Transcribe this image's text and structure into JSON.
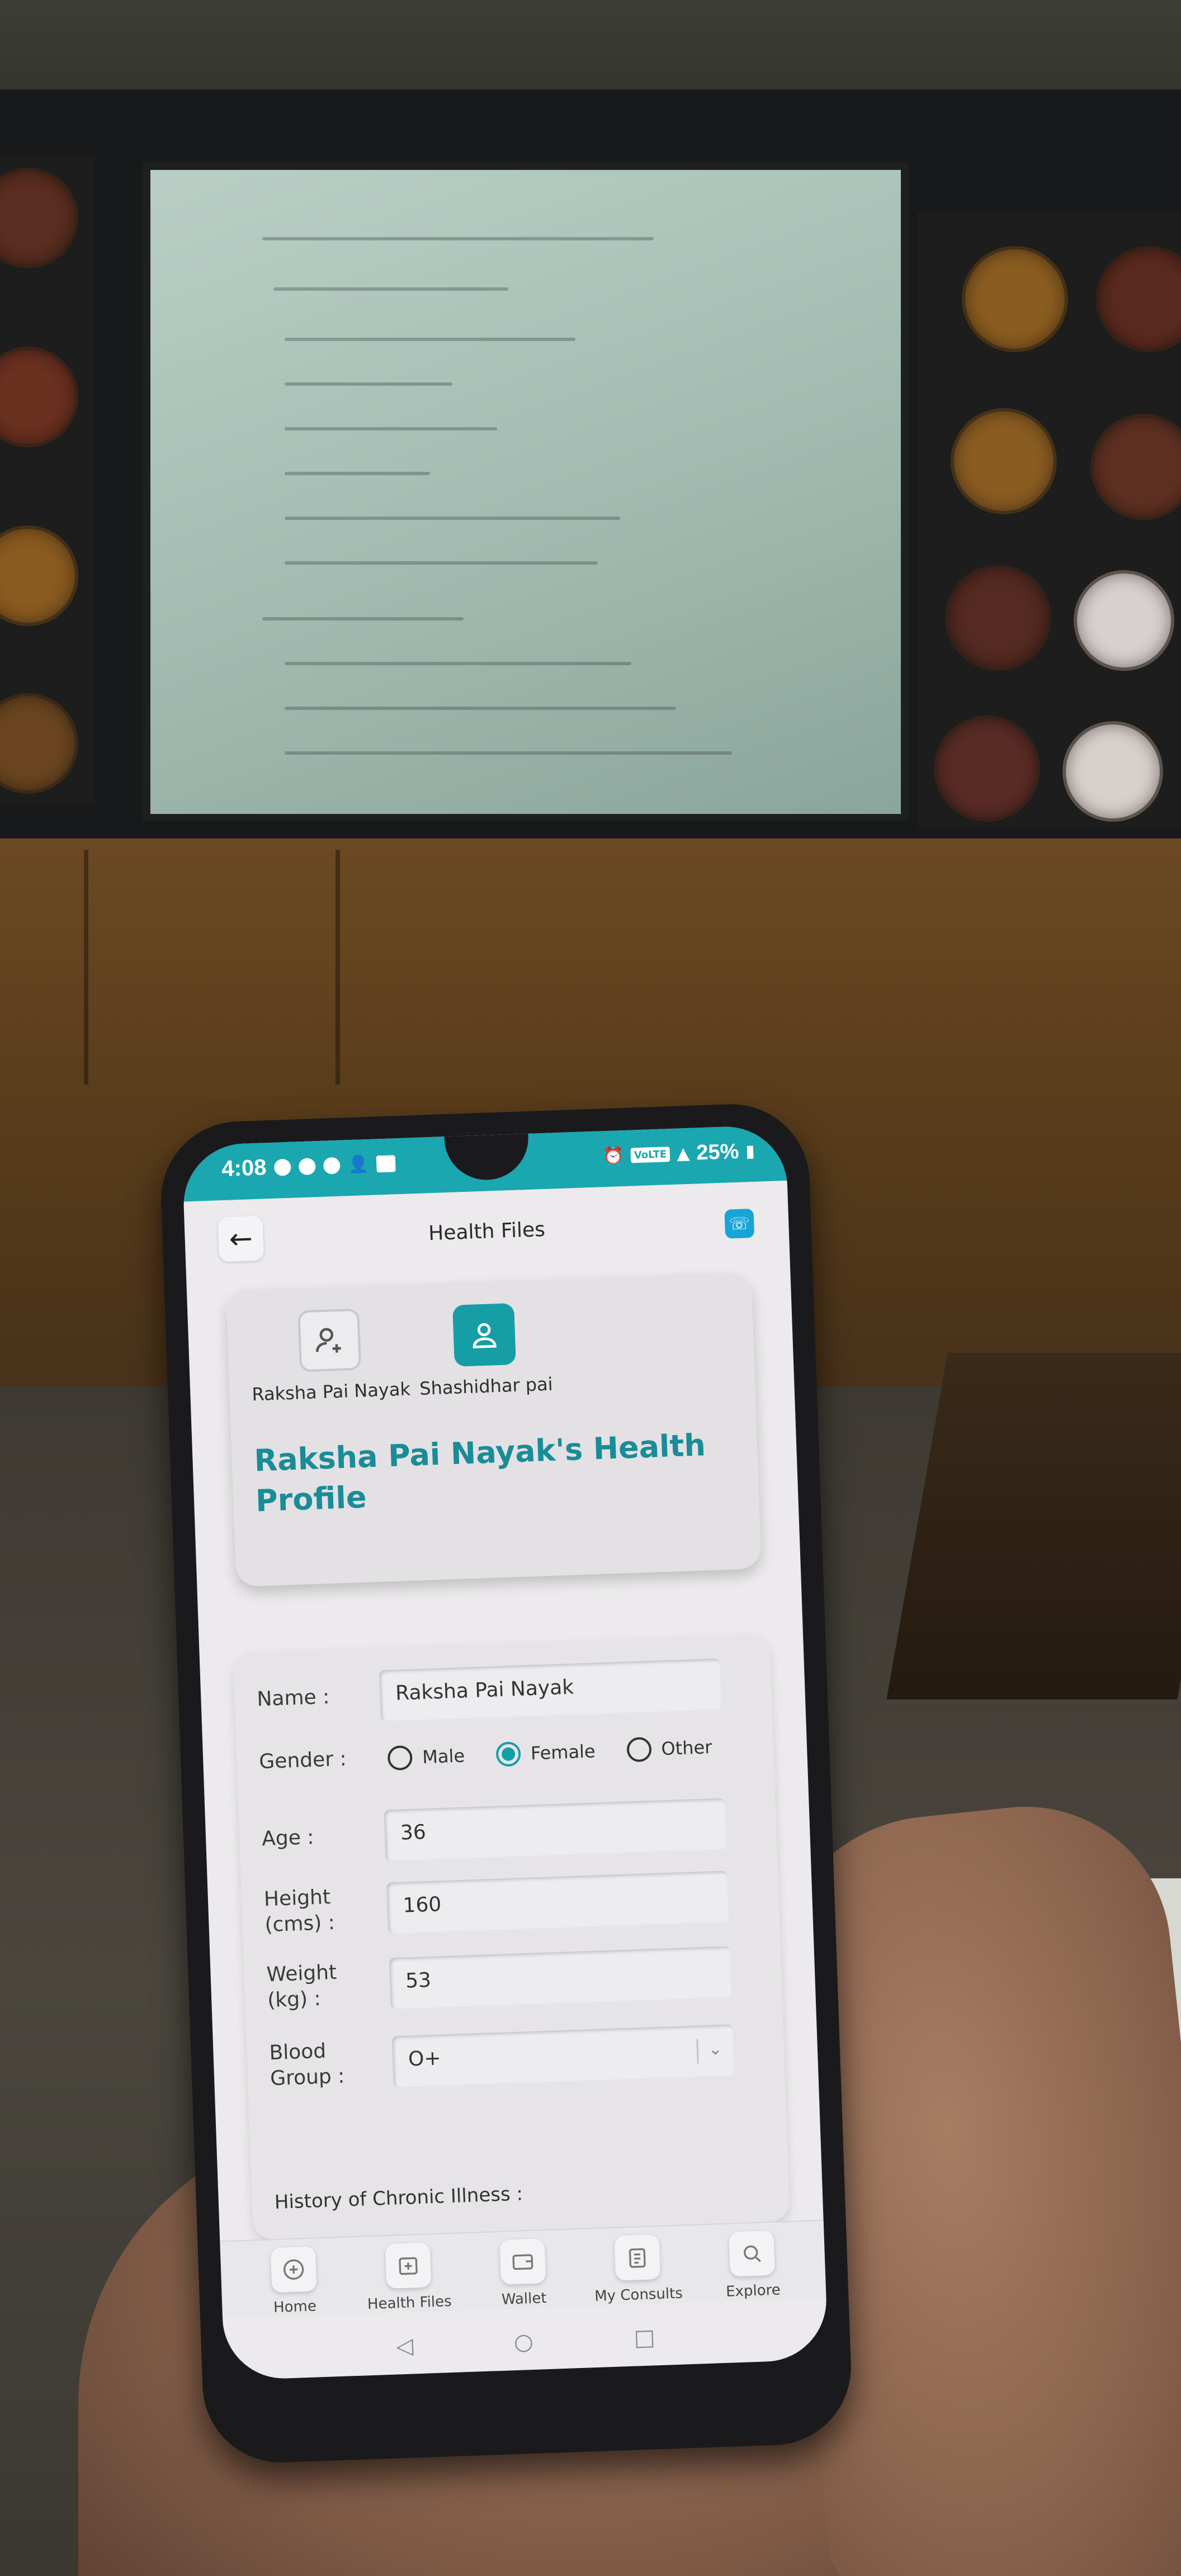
{
  "status_bar": {
    "time": "4:08",
    "network_label": "VoLTE",
    "battery": "25%"
  },
  "app_bar": {
    "title": "Health Files",
    "back_icon": "←",
    "call_icon": "☏"
  },
  "profile_card": {
    "members": [
      {
        "name": "Raksha Pai Nayak",
        "icon": "add-user-icon",
        "selected": false
      },
      {
        "name": "Shashidhar pai",
        "icon": "user-icon",
        "selected": true
      }
    ],
    "heading": "Raksha Pai Nayak's Health Profile"
  },
  "form": {
    "name_label": "Name :",
    "name_value": "Raksha Pai Nayak",
    "gender_label": "Gender :",
    "gender_options": [
      "Male",
      "Female",
      "Other"
    ],
    "gender_selected": "Female",
    "age_label": "Age :",
    "age_value": "36",
    "height_label_1": "Height",
    "height_label_2": "(cms) :",
    "height_value": "160",
    "weight_label_1": "Weight",
    "weight_label_2": "(kg) :",
    "weight_value": "53",
    "blood_label_1": "Blood",
    "blood_label_2": "Group :",
    "blood_value": "O+",
    "chronic_label": "History of Chronic Illness :"
  },
  "bottom_nav": {
    "items": [
      {
        "label": "Home",
        "icon": "home-icon"
      },
      {
        "label": "Health Files",
        "icon": "health-files-icon"
      },
      {
        "label": "Wallet",
        "icon": "wallet-icon"
      },
      {
        "label": "My Consults",
        "icon": "clipboard-icon"
      },
      {
        "label": "Explore",
        "icon": "explore-icon"
      }
    ]
  },
  "system_nav": {
    "back": "◁",
    "home": "○",
    "recents": "□"
  },
  "colors": {
    "accent": "#169ea6",
    "status_bar": "#1aa7b0",
    "heading": "#198c97",
    "call_button": "#18a4d6"
  }
}
